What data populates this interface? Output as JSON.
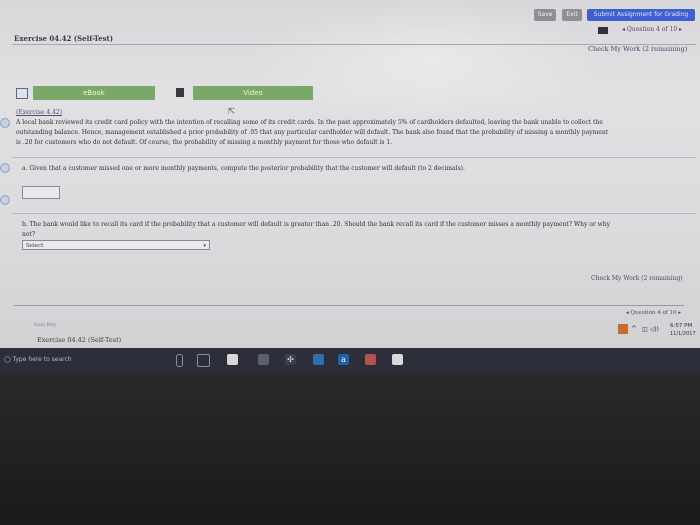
{
  "toolbar": {
    "save_label": "Save",
    "exit_label": "Exit",
    "submit_label": "Submit Assignment for Grading"
  },
  "header": {
    "exercise_title": "Exercise 04.42 (Self-Test)",
    "question_nav": "◂ Question 4 of 10 ▸",
    "check_work": "Check My Work (2 remaining)"
  },
  "tabs": {
    "ebook_label": "eBook",
    "video_label": "Video"
  },
  "problem": {
    "ref": "(Exercise 4.42)",
    "line1": "A local bank reviewed its credit card policy with the intention of recalling some of its credit cards. In the past approximately 5% of cardholders defaulted, leaving the bank unable to collect the",
    "line2": "outstanding balance. Hence, management established a prior probability of .05 that any particular cardholder will default. The bank also found that the probability of missing a monthly payment",
    "line3": "is .20 for customers who do not default. Of course, the probability of missing a monthly payment for those who default is 1."
  },
  "part_a": {
    "text": "a. Given that a customer missed one or more monthly payments, compute the posterior probability that the customer will default (to 2 decimals).",
    "value": ""
  },
  "part_b": {
    "text1": "b. The bank would like to recall its card if the probability that a customer will default is greater than .20. Should the bank recall its card if the customer misses a monthly payment? Why or why",
    "text2": "not?",
    "select_value": "Select"
  },
  "footer": {
    "check_work": "Check My Work (2 remaining)",
    "question_nav": "◂ Question 4 of 10 ▸",
    "icon_label": "Icon Key",
    "exercise_title": "Exercise 04.42 (Self-Test)"
  },
  "taskbar": {
    "search_placeholder": "Type here to search",
    "time": "6:57 PM",
    "date": "11/1/2017"
  },
  "colors": {
    "ebook_green": "#7aa866",
    "submit_blue": "#3f5fd0",
    "taskbar": "#2c2f3a"
  }
}
